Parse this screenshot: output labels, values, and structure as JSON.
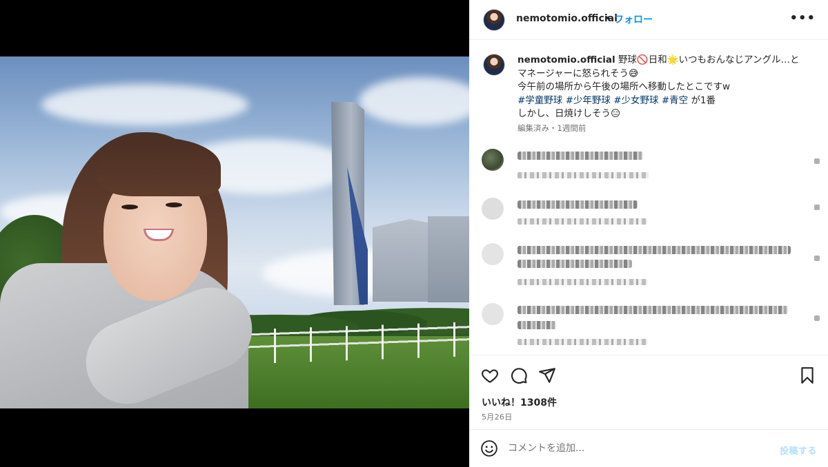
{
  "post": {
    "username": "nemotomio.official",
    "follow_label": "フォロー",
    "dot": "•",
    "more": "•••"
  },
  "caption": {
    "username": "nemotomio.official",
    "line1": "野球🚫日和🌟いつもおんなじアングル…と",
    "line2": "マネージャーに怒られそう😅",
    "line3": "今午前の場所から午後の場所へ移動したとこですw",
    "hashtags": [
      "#学童野球",
      "#少年野球",
      "#少女野球",
      "#青空"
    ],
    "line4_suffix": "が1番",
    "line5": "しかし、日焼けしそう😑",
    "meta": "編集済み・1週間前"
  },
  "actions": {
    "likes": "いいね！1308件",
    "date": "5月26日"
  },
  "add_comment": {
    "placeholder": "コメントを追加...",
    "post_label": "投稿する"
  },
  "icons": {
    "heart": "heart-icon",
    "comment": "comment-icon",
    "share": "share-icon",
    "bookmark": "bookmark-icon",
    "emoji": "emoji-icon"
  },
  "colors": {
    "accent": "#0095f6",
    "hashtag": "#00376b",
    "muted": "#737373"
  }
}
